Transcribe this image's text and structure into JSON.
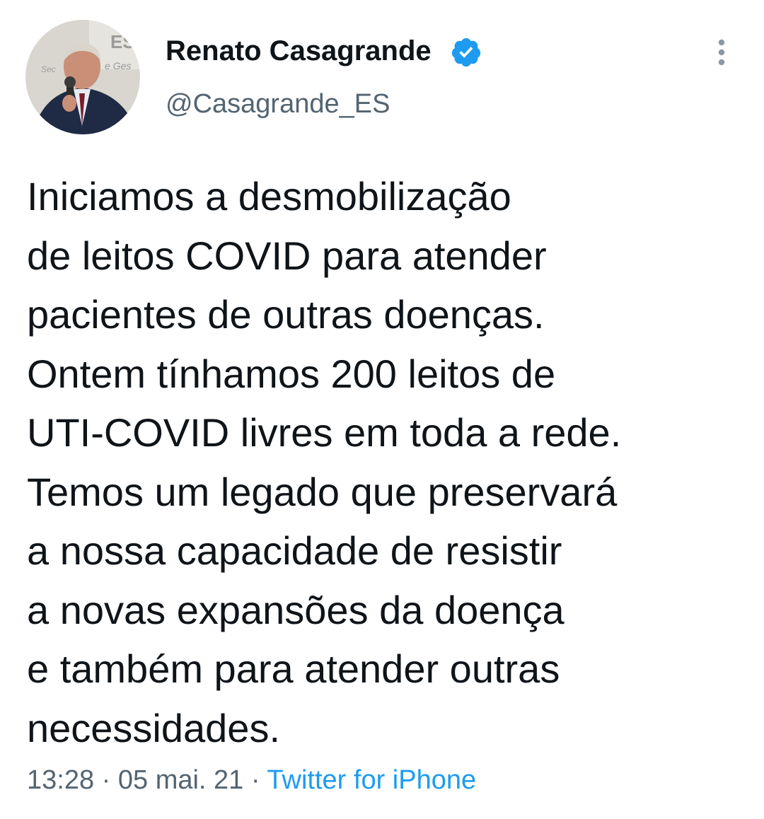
{
  "author": {
    "display_name": "Renato Casagrande",
    "handle": "@Casagrande_ES",
    "verified": true,
    "avatar_icon": "profile-photo"
  },
  "tweet": {
    "text": "Iniciamos a desmobilização\nde leitos COVID para atender\npacientes de outras doenças.\nOntem tínhamos 200 leitos de\nUTI-COVID livres em toda a rede.\nTemos um legado que preservará\na nossa capacidade de resistir\na novas expansões da doença\ne também para atender outras\nnecessidades.",
    "time": "13:28",
    "separator": "·",
    "date": "05 mai. 21",
    "source": "Twitter for iPhone"
  },
  "icons": {
    "verified": "verified-badge-icon",
    "more": "more-options-icon"
  },
  "colors": {
    "text": "#0f1419",
    "secondary": "#536471",
    "accent": "#1d9bf0"
  }
}
